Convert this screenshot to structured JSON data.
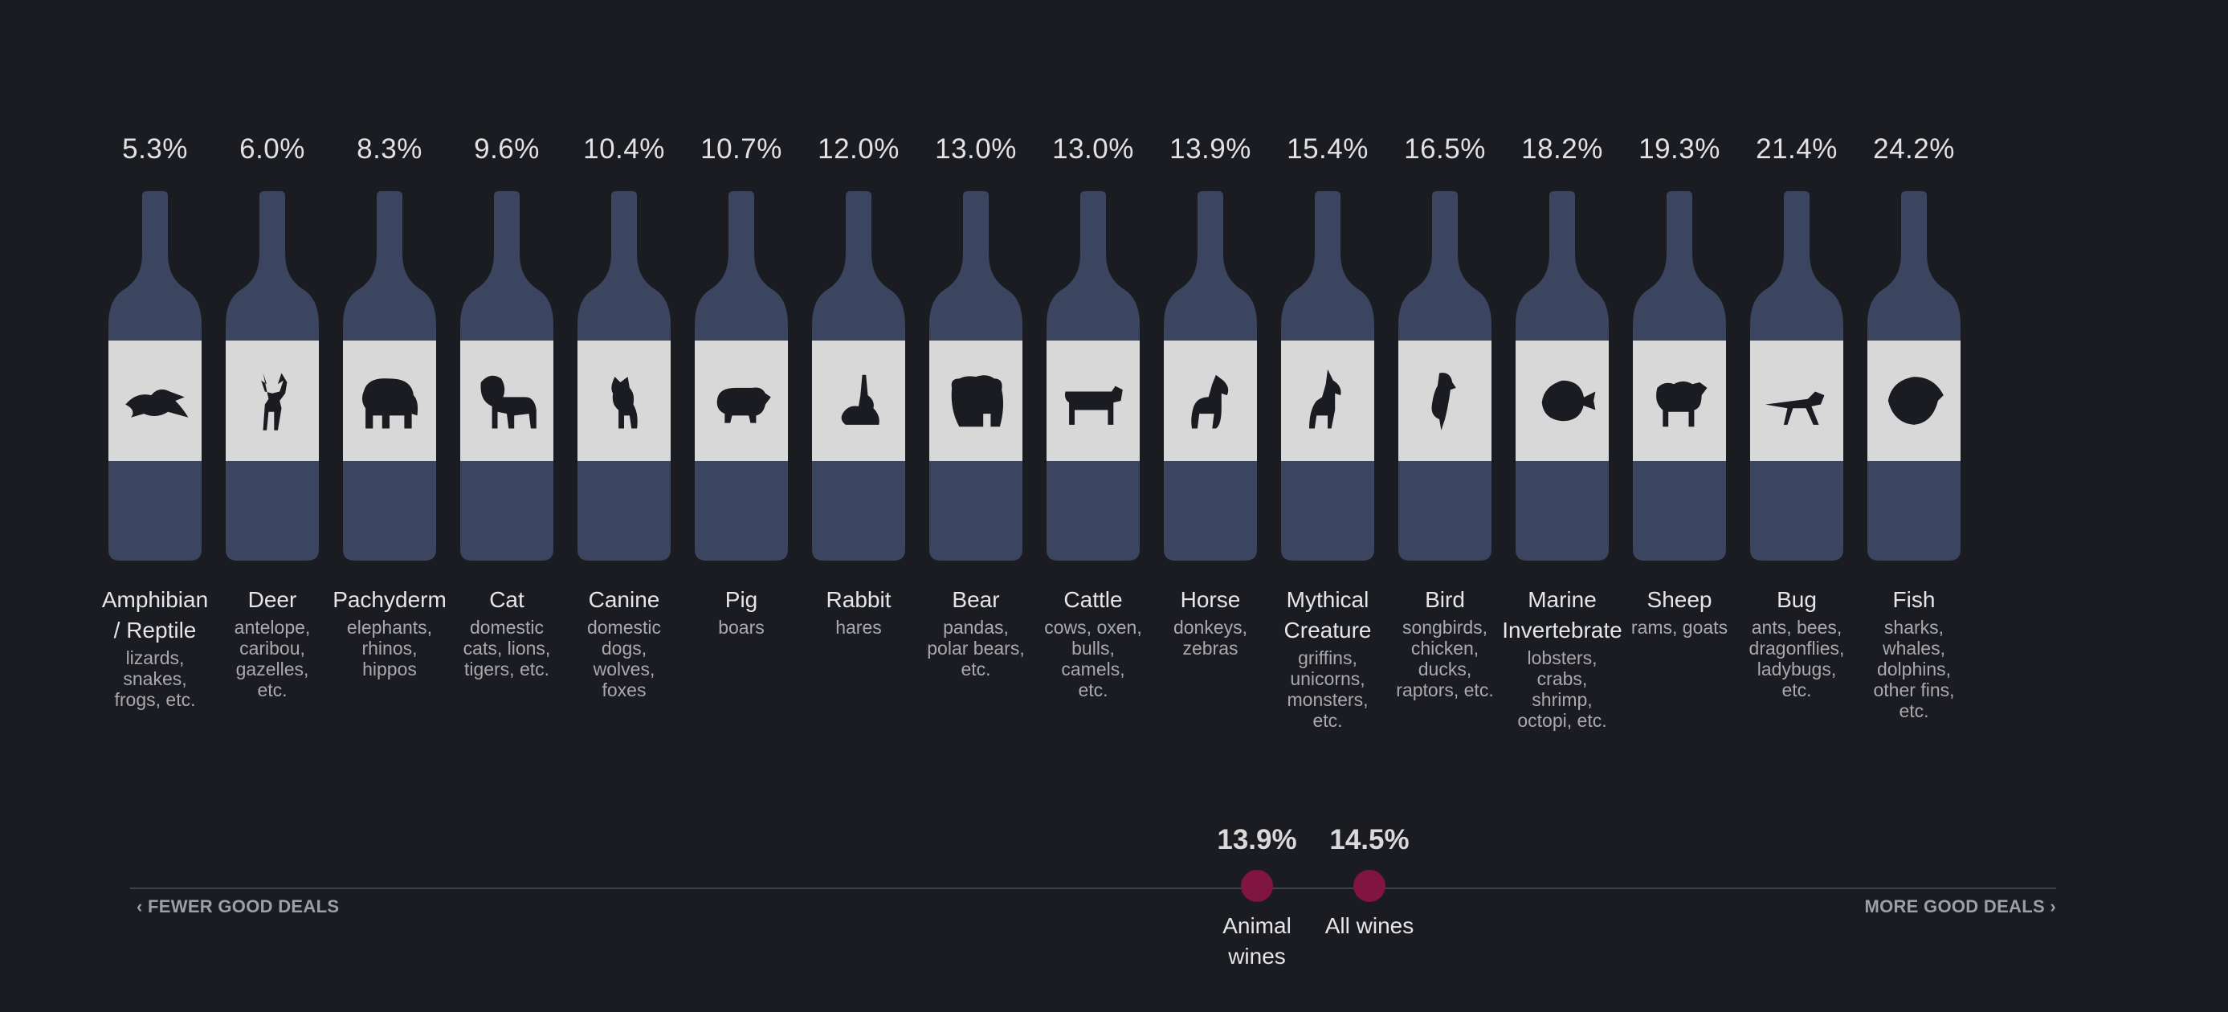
{
  "colors": {
    "background": "#1b1c21",
    "bottle": "#3b455f",
    "label": "#d8d8d8",
    "icon": "#1b1c21",
    "marker": "#7f1540",
    "axis": "#3f4150"
  },
  "chart_data": {
    "type": "bar",
    "categories": [
      "Amphibian / Reptile",
      "Deer",
      "Pachyderm",
      "Cat",
      "Canine",
      "Pig",
      "Rabbit",
      "Bear",
      "Cattle",
      "Horse",
      "Mythical Creature",
      "Bird",
      "Marine Invertebrate",
      "Sheep",
      "Bug",
      "Fish"
    ],
    "values": [
      5.3,
      6.0,
      8.3,
      9.6,
      10.4,
      10.7,
      12.0,
      13.0,
      13.0,
      13.9,
      15.4,
      16.5,
      18.2,
      19.3,
      21.4,
      24.2
    ],
    "value_labels": [
      "5.3%",
      "6.0%",
      "8.3%",
      "9.6%",
      "10.4%",
      "10.7%",
      "12.0%",
      "13.0%",
      "13.0%",
      "13.9%",
      "15.4%",
      "16.5%",
      "18.2%",
      "19.3%",
      "21.4%",
      "24.2%"
    ],
    "items": [
      {
        "name": "Amphibian / Reptile",
        "examples": "lizards, snakes, frogs, etc.",
        "icon": "lizard-icon"
      },
      {
        "name": "Deer",
        "examples": "antelope, caribou, gazelles, etc.",
        "icon": "deer-icon"
      },
      {
        "name": "Pachyderm",
        "examples": "elephants, rhinos, hippos",
        "icon": "elephant-icon"
      },
      {
        "name": "Cat",
        "examples": "domestic cats, lions, tigers, etc.",
        "icon": "lion-icon"
      },
      {
        "name": "Canine",
        "examples": "domestic dogs, wolves, foxes",
        "icon": "dog-icon"
      },
      {
        "name": "Pig",
        "examples": "boars",
        "icon": "pig-icon"
      },
      {
        "name": "Rabbit",
        "examples": "hares",
        "icon": "rabbit-icon"
      },
      {
        "name": "Bear",
        "examples": "pandas, polar bears, etc.",
        "icon": "bear-icon"
      },
      {
        "name": "Cattle",
        "examples": "cows, oxen, bulls, camels, etc.",
        "icon": "cow-icon"
      },
      {
        "name": "Horse",
        "examples": "donkeys, zebras",
        "icon": "horse-icon"
      },
      {
        "name": "Mythical Creature",
        "examples": "griffins, unicorns, monsters, etc.",
        "icon": "unicorn-icon"
      },
      {
        "name": "Bird",
        "examples": "songbirds, chicken, ducks, raptors, etc.",
        "icon": "bird-icon"
      },
      {
        "name": "Marine Invertebrate",
        "examples": "lobsters, crabs, shrimp, octopi, etc.",
        "icon": "nautilus-icon"
      },
      {
        "name": "Sheep",
        "examples": "rams, goats",
        "icon": "sheep-icon"
      },
      {
        "name": "Bug",
        "examples": "ants, bees, dragonflies, ladybugs, etc.",
        "icon": "grasshopper-icon"
      },
      {
        "name": "Fish",
        "examples": "sharks, whales, dolphins, other fins, etc.",
        "icon": "fish-icon"
      }
    ],
    "scale": {
      "left_label": "FEWER GOOD DEALS",
      "right_label": "MORE GOOD DEALS",
      "markers": [
        {
          "value": 13.9,
          "value_label": "13.9%",
          "label": "Animal wines"
        },
        {
          "value": 14.5,
          "value_label": "14.5%",
          "label": "All wines"
        }
      ]
    }
  }
}
